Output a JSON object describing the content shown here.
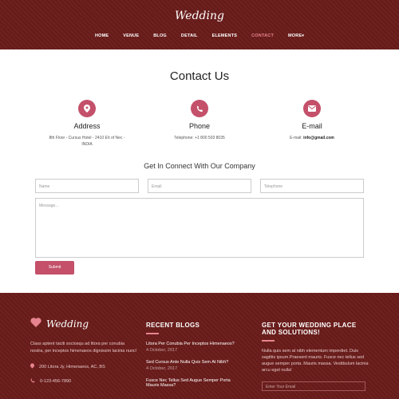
{
  "header": {
    "logo": "Wedding",
    "nav": [
      {
        "label": "HOME"
      },
      {
        "label": "VENUE"
      },
      {
        "label": "BLOG"
      },
      {
        "label": "DETAIL"
      },
      {
        "label": "ELEMENTS"
      },
      {
        "label": "CONTACT"
      },
      {
        "label": "MORE"
      }
    ],
    "active": "CONTACT"
  },
  "contact": {
    "title": "Contact Us",
    "address": {
      "label": "Address",
      "line1": "8th Floor - Cursus Hotel - 2410 E\\t of Nec -",
      "line2": "INDIA",
      "icon": "map-pin-icon"
    },
    "phone": {
      "label": "Phone",
      "text": "Telephone: +1 800 503 8035",
      "icon": "phone-icon"
    },
    "email": {
      "label": "E-mail",
      "prefix": "E-mail: ",
      "value": "info@gmail.com",
      "icon": "envelope-icon"
    },
    "subtitle": "Get In Connect With Our Company",
    "form": {
      "name_placeholder": "Name",
      "email_placeholder": "Email",
      "phone_placeholder": "Telephone",
      "message_placeholder": "Message...",
      "submit_label": "Submit"
    }
  },
  "footer": {
    "logo": "Wedding",
    "about": "Class aptent taciti sociosqu ad litora per conubia nostra, per inceptos himenaeos dignissim lacinia nunc!",
    "address": "200 Litora Jy, Himenaeos, AC, BS",
    "phone": "0-123-456-7890",
    "recent_blogs_title": "RECENT BLOGS",
    "blogs": [
      {
        "title": "Litora Per Conubia Per Inceptos Himenaeos?",
        "date": "4 October, 2017"
      },
      {
        "title": "Sed Cursus Ante Nulla Quis Sem At Nibh?",
        "date": "4 October, 2017"
      },
      {
        "title": "Fusce Nec Tellus Sed Augue Semper Porta",
        "date": ""
      },
      {
        "title": "Mauris Massa?",
        "date": ""
      }
    ],
    "cta_title_line1": "GET YOUR WEDDING PLACE",
    "cta_title_line2": "AND SOLUTIONS!",
    "cta_text": "Nulla quis sem at nibh elementum imperdiet. Duis sagittis ipsum.Praesent mauris. Fusce nec tellus sed augue semper porta. Mauris massa. Vestibulum lacinia arcu eget nulla!",
    "newsletter_placeholder": "Enter Your Email"
  },
  "colors": {
    "primary": "#6b1d1b",
    "accent": "#c4506a",
    "active_nav": "#e8848f"
  }
}
